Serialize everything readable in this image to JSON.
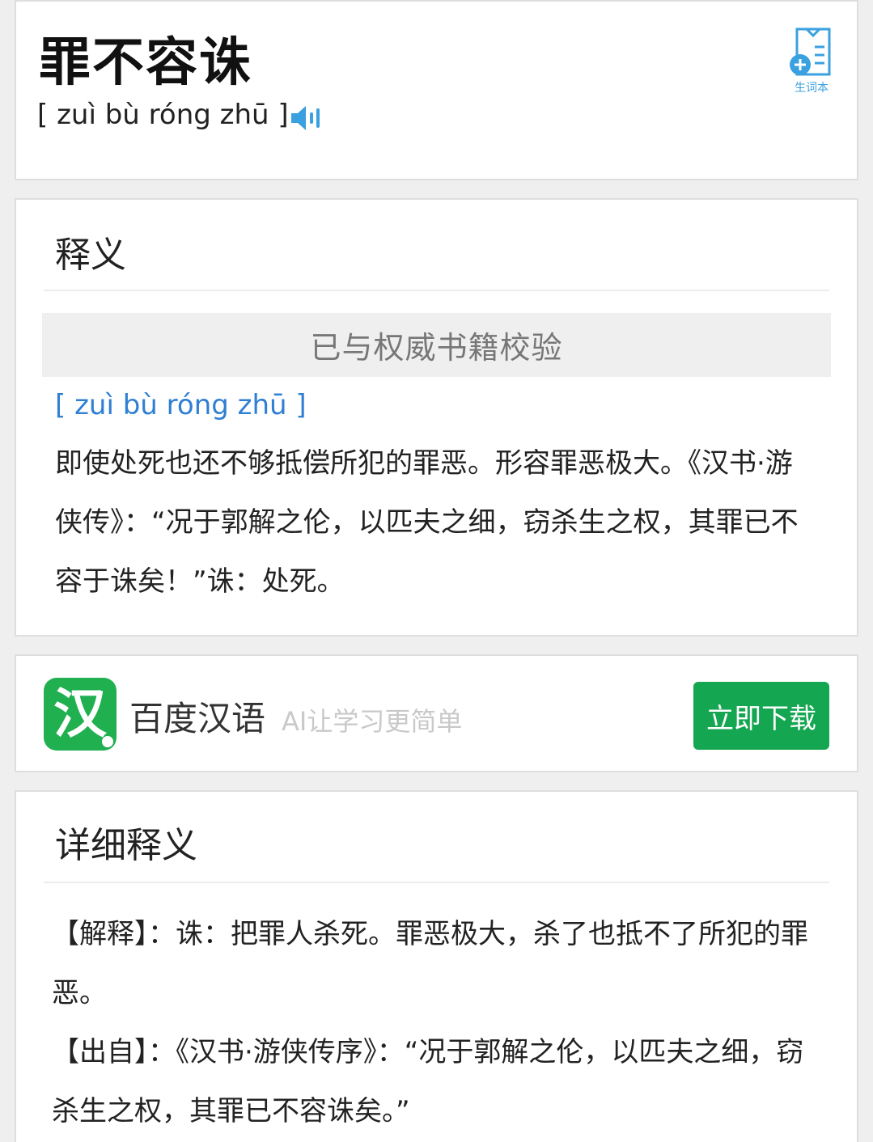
{
  "header": {
    "word": "罪不容诛",
    "pinyin": "[ zuì bù róng zhū ]",
    "vocab_label": "生词本"
  },
  "definition": {
    "title": "释义",
    "verified": "已与权威书籍校验",
    "pinyin": "[ zuì bù róng zhū ]",
    "text": "即使处死也还不够抵偿所犯的罪恶。形容罪恶极大。《汉书·游侠传》：“况于郭解之伦，以匹夫之细，窃杀生之权，其罪已不容于诛矣！”诛：处死。"
  },
  "ad": {
    "logo_char": "汉",
    "app_name": "百度汉语",
    "slogan": "AI让学习更简单",
    "download_label": "立即下载"
  },
  "detail": {
    "title": "详细释义",
    "explain_label": "【解释】：",
    "explain_text": "诛：把罪人杀死。罪恶极大，杀了也抵不了所犯的罪恶。",
    "source_label": "【出自】：",
    "source_text": "《汉书·游侠传序》：“况于郭解之伦，以匹夫之细，窃杀生之权，其罪已不容诛矣。”"
  },
  "colors": {
    "accent_blue": "#2f7fd3",
    "brand_green": "#14a650",
    "icon_blue": "#3aa0e0"
  }
}
